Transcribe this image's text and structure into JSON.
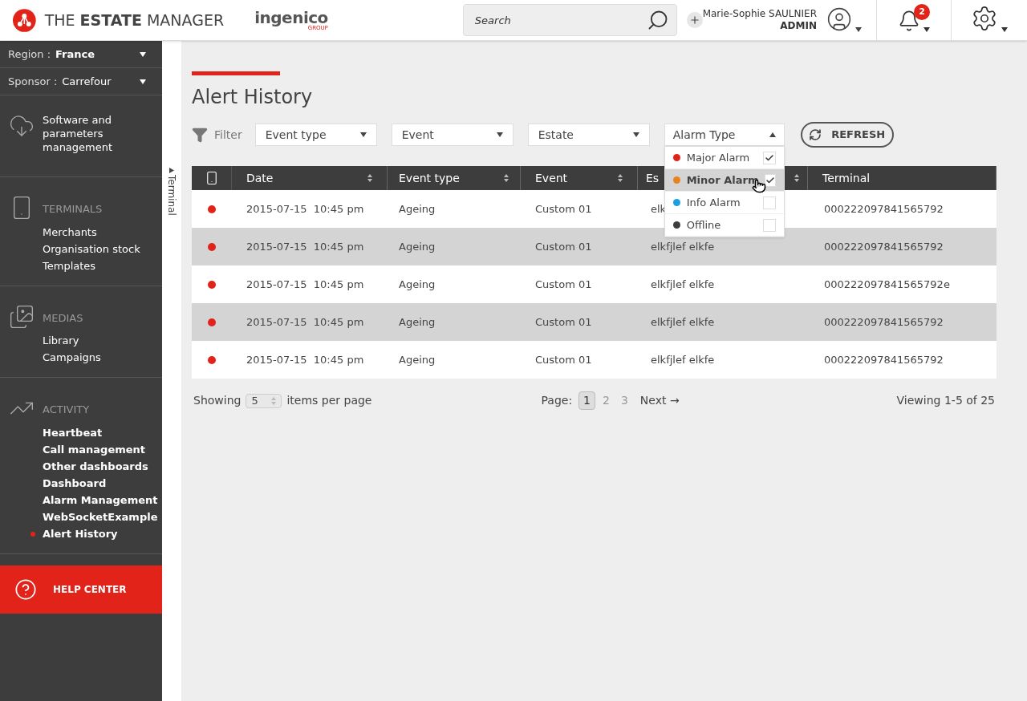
{
  "header": {
    "logo_text": {
      "light": "THE ",
      "bold": "ESTATE",
      "rest": " MANAGER"
    },
    "partner": {
      "name": "ingenico",
      "sub": "GROUP"
    },
    "search": {
      "placeholder": "Search"
    },
    "user": {
      "name": "Marie-Sophie SAULNIER",
      "role": "ADMIN"
    },
    "notifications": {
      "count": "2"
    }
  },
  "sidebar": {
    "selectors": [
      {
        "label": "Region :",
        "value": "France",
        "bold": true
      },
      {
        "label": "Sponsor :",
        "value": "Carrefour",
        "bold": false
      }
    ],
    "sections": [
      {
        "kind": "cloud",
        "title": "Software and parameters management"
      },
      {
        "kind": "terminal",
        "title": "TERMINALS",
        "items": [
          {
            "label": "Merchants",
            "selected": false
          },
          {
            "label": "Organisation stock",
            "selected": false
          },
          {
            "label": "Templates",
            "selected": false
          }
        ]
      },
      {
        "kind": "media",
        "title": "MEDIAS",
        "items": [
          {
            "label": "Library",
            "selected": false
          },
          {
            "label": "Campaigns",
            "selected": false
          }
        ]
      },
      {
        "kind": "activity",
        "title": "ACTIVITY",
        "bold_items": true,
        "items": [
          {
            "label": "Heartbeat",
            "selected": false
          },
          {
            "label": "Call management",
            "selected": false
          },
          {
            "label": "Other dashboards",
            "selected": false
          },
          {
            "label": "Dashboard",
            "selected": false
          },
          {
            "label": "Alarm Management",
            "selected": false
          },
          {
            "label": "WebSocketExample",
            "selected": false
          },
          {
            "label": "Alert History",
            "selected": true
          }
        ]
      }
    ],
    "help": "HELP CENTER"
  },
  "side_tab": "Terminal",
  "page_title": "Alert History",
  "filter": {
    "label": "Filter",
    "selects": [
      "Event type",
      "Event",
      "Estate"
    ],
    "alarm_type": {
      "label": "Alarm Type",
      "expanded": true,
      "options": [
        {
          "label": "Major Alarm",
          "color": "#e2231a",
          "checked": true,
          "highlighted": false
        },
        {
          "label": "Minor Alarm",
          "color": "#e8821e",
          "checked": true,
          "highlighted": true
        },
        {
          "label": "Info Alarm",
          "color": "#1ba1e2",
          "checked": false,
          "highlighted": false
        },
        {
          "label": "Offline",
          "color": "#3d3d3d",
          "checked": false,
          "highlighted": false
        }
      ]
    },
    "refresh": "REFRESH"
  },
  "table": {
    "columns": [
      "Date",
      "Event type",
      "Event",
      "Es",
      "Terminal"
    ],
    "rows": [
      {
        "color": "#e2231a",
        "date": "2015-07-15",
        "time": "10:45 pm",
        "event_type": "Ageing",
        "event": "Custom 01",
        "estate": "elk",
        "terminal": "000222097841565792"
      },
      {
        "color": "#e2231a",
        "date": "2015-07-15",
        "time": "10:45 pm",
        "event_type": "Ageing",
        "event": "Custom 01",
        "estate": "elkfjlef elkfe",
        "terminal": "000222097841565792"
      },
      {
        "color": "#e2231a",
        "date": "2015-07-15",
        "time": "10:45 pm",
        "event_type": "Ageing",
        "event": "Custom 01",
        "estate": "elkfjlef elkfe",
        "terminal": "000222097841565792e"
      },
      {
        "color": "#e2231a",
        "date": "2015-07-15",
        "time": "10:45 pm",
        "event_type": "Ageing",
        "event": "Custom 01",
        "estate": "elkfjlef elkfe",
        "terminal": "000222097841565792"
      },
      {
        "color": "#e2231a",
        "date": "2015-07-15",
        "time": "10:45 pm",
        "event_type": "Ageing",
        "event": "Custom 01",
        "estate": "elkfjlef elkfe",
        "terminal": "000222097841565792"
      }
    ]
  },
  "pagination": {
    "showing": "Showing",
    "per_page": "5",
    "per_page_suffix": "items per page",
    "page_label": "Page:",
    "pages": [
      {
        "label": "1",
        "selected": true
      },
      {
        "label": "2",
        "selected": false
      },
      {
        "label": "3",
        "selected": false
      }
    ],
    "next": "Next →",
    "viewing": "Viewing 1-5 of 25"
  }
}
